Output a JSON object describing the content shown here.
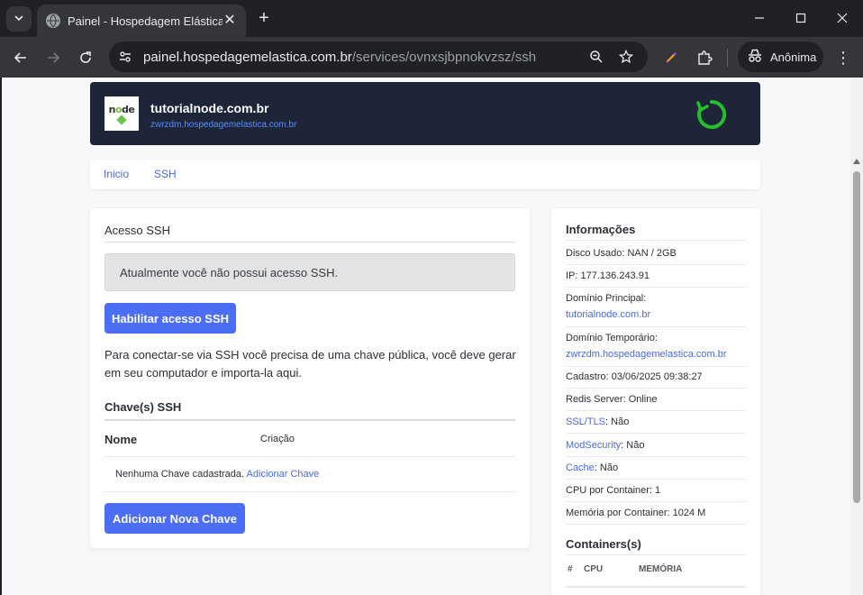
{
  "browser": {
    "tab_title": "Painel - Hospedagem Elástica",
    "url_host": "painel.hospedagemelastica.com.br",
    "url_path": "/services/ovnxsjbpnokvzsz/ssh",
    "incognito_label": "Anônima"
  },
  "header": {
    "domain": "tutorialnode.com.br",
    "temp_domain": "zwrzdm.hospedagemelastica.com.br",
    "logo_text_1": "n",
    "logo_text_2": "de"
  },
  "breadcrumb": {
    "home": "Inicio",
    "current": "SSH"
  },
  "ssh": {
    "title": "Acesso SSH",
    "alert": "Atualmente você não possui acesso SSH.",
    "enable_button": "Habilitar acesso SSH",
    "instructions": "Para conectar-se via SSH você precisa de uma chave pública, você deve gerar em seu computador e importa-la aqui.",
    "keys_title": "Chave(s) SSH",
    "col_name": "Nome",
    "col_created": "Criação",
    "empty_text": "Nenhuma Chave cadastrada.",
    "empty_link": "Adicionar Chave",
    "add_button": "Adicionar Nova Chave"
  },
  "info": {
    "title": "Informações",
    "disk": "Disco Usado: NAN / 2GB",
    "ip": "IP: 177.136.243.91",
    "main_domain_label": "Domínio Principal:",
    "main_domain": "tutorialnode.com.br",
    "temp_domain_label": "Domínio Temporário:",
    "temp_domain": "zwrzdm.hospedagemelastica.com.br",
    "created": "Cadastro: 03/06/2025 09:38:27",
    "redis": "Redis Server: Online",
    "ssl_link": "SSL/TLS",
    "ssl_value": ": Não",
    "modsec_link": "ModSecurity",
    "modsec_value": ": Não",
    "cache_link": "Cache",
    "cache_value": ": Não",
    "cpu": "CPU por Container: 1",
    "memory": "Memória por Container: 1024 M",
    "containers_title": "Containers(s)",
    "col_hash": "#",
    "col_cpu": "CPU",
    "col_mem": "MEMÓRIA"
  },
  "colors": {
    "accent": "#4c6ef5",
    "header_bg": "#1e2539",
    "link": "#4b6bd8",
    "refresh": "#22c02a"
  }
}
